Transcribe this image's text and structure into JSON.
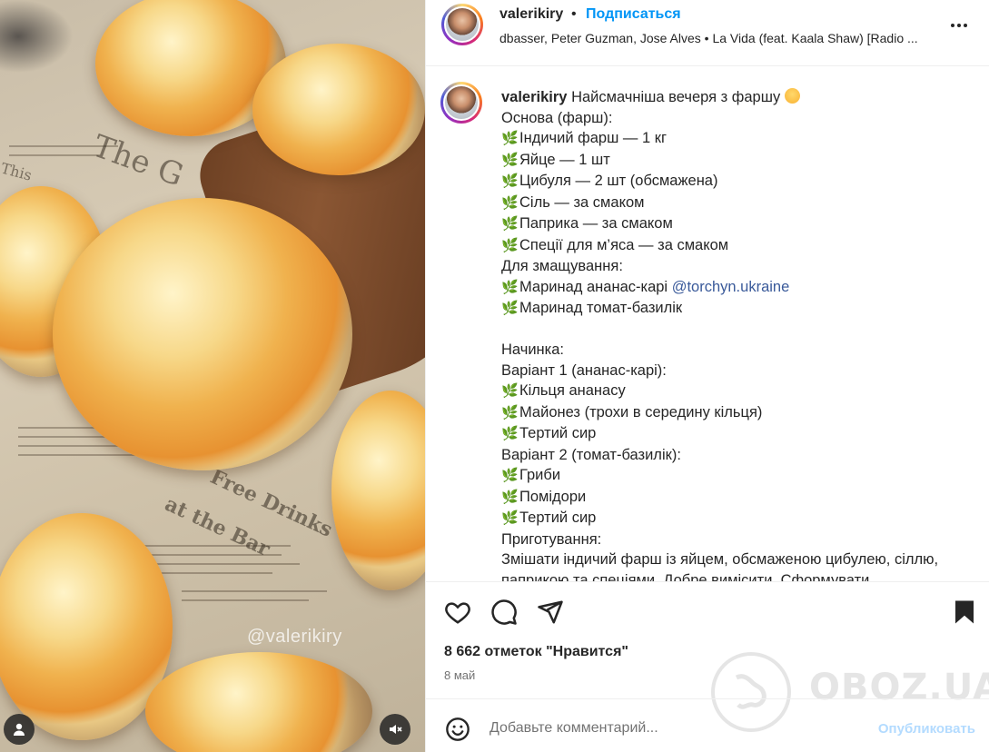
{
  "post": {
    "username": "valerikiry",
    "separator": "•",
    "follow_label": "Подписаться",
    "audio_text": "dbasser, Peter Guzman, Jose Alves • La Vida (feat. Kaala Shaw) [Radio ...",
    "media_watermark": "@valerikiry",
    "more_icon": "more-horizontal-icon"
  },
  "caption": {
    "username": "valerikiry",
    "title": "Найсмачніша вечеря з фаршу",
    "lines": {
      "l1": "Основа (фарш):",
      "l2": "Індичий фарш — 1 кг",
      "l3": "Яйце — 1 шт",
      "l4": "Цибуля — 2 шт (обсмажена)",
      "l5": "Сіль — за смаком",
      "l6": "Паприка — за смаком",
      "l7": "Спеції для м’яса — за смаком",
      "l8": "Для змащування:",
      "l9": "Маринад ананас-карі",
      "l9_mention": "@torchyn.ukraine",
      "l10": "Маринад томат-базилік",
      "l11": "Начинка:",
      "l12": "Варіант 1 (ананас-карі):",
      "l13": "Кільця ананасу",
      "l14": "Майонез (трохи в середину кільця)",
      "l15": "Тертий сир",
      "l16": "Варіант 2 (томат-базилік):",
      "l17": "Гриби",
      "l18": "Помідори",
      "l19": "Тертий сир",
      "l20": "Приготування:",
      "l21": "Змішати індичий фарш із яйцем, обсмаженою цибулею, сіллю, паприкою та спеціями. Добре вимісити. Сформувати"
    }
  },
  "actions": {
    "like_icon": "heart-icon",
    "comment_icon": "comment-icon",
    "share_icon": "share-icon",
    "save_icon": "bookmark-icon"
  },
  "stats": {
    "likes": "8 662 отметок \"Нравится\"",
    "date": "8 май"
  },
  "watermark": {
    "brand": "OBOZ.UA"
  },
  "comment": {
    "placeholder": "Добавьте комментарий...",
    "publish_label": "Опубликовать"
  },
  "colors": {
    "accent": "#0095f6",
    "publish_disabled": "#b3dbff",
    "text": "#262626",
    "muted": "#737373",
    "border": "#efefef"
  }
}
